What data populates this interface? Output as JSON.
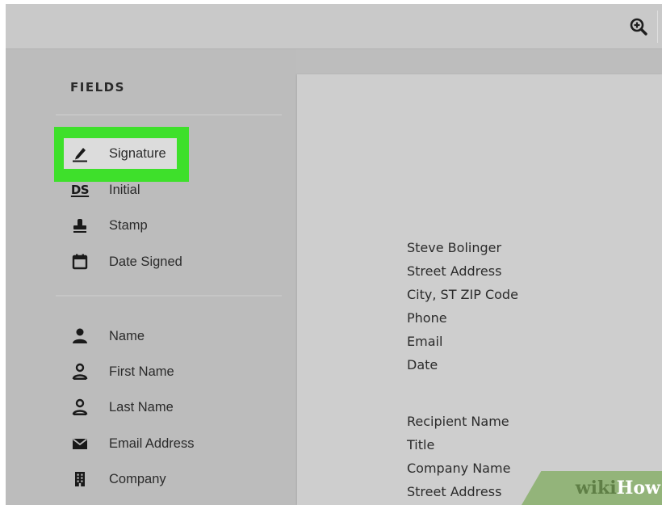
{
  "toolbar": {
    "zoom_icon": "zoom-in-icon"
  },
  "sidebar": {
    "title": "FIELDS",
    "group1": [
      {
        "label": "Signature",
        "icon": "pen-icon"
      },
      {
        "label": "Initial",
        "icon": "initials-icon",
        "icon_text": "DS"
      },
      {
        "label": "Stamp",
        "icon": "stamp-icon"
      },
      {
        "label": "Date Signed",
        "icon": "calendar-icon"
      }
    ],
    "group2": [
      {
        "label": "Name",
        "icon": "person-icon"
      },
      {
        "label": "First Name",
        "icon": "person-outline-icon"
      },
      {
        "label": "Last Name",
        "icon": "person-outline-icon"
      },
      {
        "label": "Email Address",
        "icon": "envelope-icon"
      },
      {
        "label": "Company",
        "icon": "building-icon"
      }
    ]
  },
  "document": {
    "sender": [
      "Steve Bolinger",
      "Street Address",
      "City, ST ZIP Code",
      "Phone",
      "Email",
      "Date"
    ],
    "recipient": [
      "Recipient Name",
      "Title",
      "Company Name",
      "Street Address"
    ]
  },
  "watermark": {
    "wiki": "wiki",
    "how": "How"
  },
  "colors": {
    "highlight": "#3ee02b",
    "sidebar": "#bcbcbc",
    "document": "#cecece"
  }
}
